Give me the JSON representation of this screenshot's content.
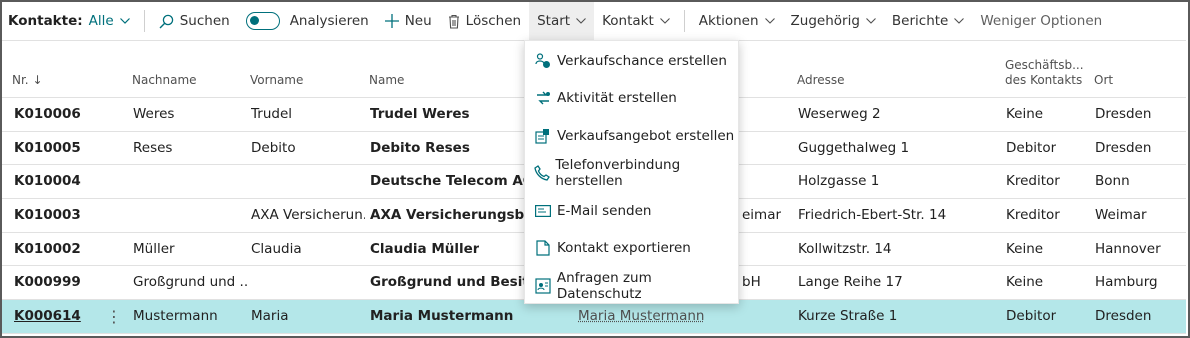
{
  "toolbar": {
    "label": "Kontakte:",
    "filter": "Alle",
    "search": "Suchen",
    "analyze": "Analysieren",
    "new": "Neu",
    "delete": "Löschen",
    "start": "Start",
    "contact": "Kontakt",
    "actions": "Aktionen",
    "related": "Zugehörig",
    "reports": "Berichte",
    "fewer": "Weniger Optionen"
  },
  "columns": {
    "nr": "Nr. ↓",
    "last": "Nachname",
    "first": "Vorname",
    "name": "Name",
    "address": "Adresse",
    "business_l1": "Geschäftsb...",
    "business_l2": "des Kontakts",
    "city": "Ort"
  },
  "rows": [
    {
      "nr": "K010006",
      "last": "Weres",
      "first": "Trudel",
      "name": "Trudel Weres",
      "company": "",
      "address": "Weserweg 2",
      "business": "Keine",
      "city": "Dresden"
    },
    {
      "nr": "K010005",
      "last": "Reses",
      "first": "Debito",
      "name": "Debito Reses",
      "company": "",
      "address": "Guggethalweg 1",
      "business": "Debitor",
      "city": "Dresden"
    },
    {
      "nr": "K010004",
      "last": "",
      "first": "",
      "name": "Deutsche Telecom AG",
      "company": "",
      "address": "Holzgasse 1",
      "business": "Kreditor",
      "city": "Bonn"
    },
    {
      "nr": "K010003",
      "last": "",
      "first": "AXA Versicherun...",
      "name": "AXA Versicherungsbüro",
      "company": "eimar",
      "address": "Friedrich-Ebert-Str. 14",
      "business": "Kreditor",
      "city": "Weimar"
    },
    {
      "nr": "K010002",
      "last": "Müller",
      "first": "Claudia",
      "name": "Claudia Müller",
      "company": "",
      "address": "Kollwitzstr. 14",
      "business": "Keine",
      "city": "Hannover"
    },
    {
      "nr": "K000999",
      "last": "Großgrund und ...",
      "first": "",
      "name": "Großgrund und Besitz G",
      "company": "bH",
      "address": "Lange Reihe 17",
      "business": "Keine",
      "city": "Hamburg"
    },
    {
      "nr": "K000614",
      "last": "Mustermann",
      "first": "Maria",
      "name": "Maria Mustermann",
      "company": "Maria Mustermann",
      "address": "Kurze Straße 1",
      "business": "Debitor",
      "city": "Dresden"
    }
  ],
  "menu": [
    {
      "label": "Verkaufschance erstellen",
      "icon": "opportunity-icon"
    },
    {
      "label": "Aktivität erstellen",
      "icon": "activity-icon"
    },
    {
      "label": "Verkaufsangebot erstellen",
      "icon": "quote-icon"
    },
    {
      "label": "Telefonverbindung herstellen",
      "icon": "phone-icon"
    },
    {
      "label": "E-Mail senden",
      "icon": "email-icon"
    },
    {
      "label": "Kontakt exportieren",
      "icon": "export-icon"
    },
    {
      "label": "Anfragen zum Datenschutz",
      "icon": "privacy-icon"
    }
  ],
  "colors": {
    "accent": "#00707c",
    "selected_row": "#b4e7e9"
  }
}
